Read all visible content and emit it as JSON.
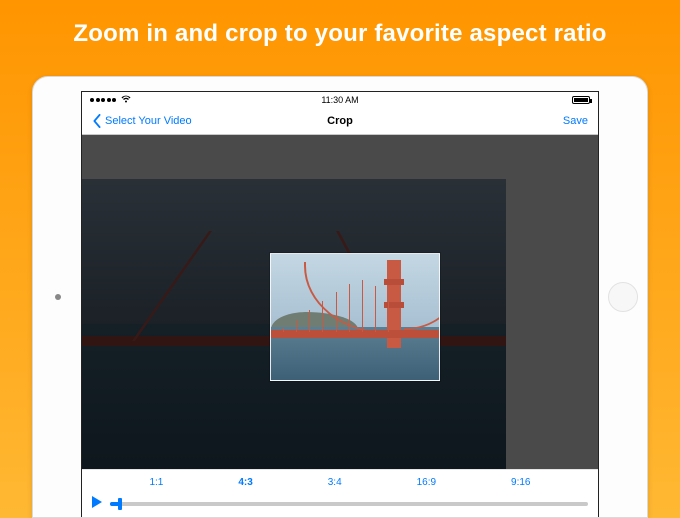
{
  "marketing": {
    "headline": "Zoom in and crop to your favorite aspect ratio"
  },
  "status": {
    "time": "11:30 AM"
  },
  "nav": {
    "back_label": "Select Your Video",
    "title": "Crop",
    "save_label": "Save"
  },
  "ratios": {
    "r1": "1:1",
    "r2": "4:3",
    "r3": "3:4",
    "r4": "16:9",
    "r5": "9:16",
    "selected": "4:3"
  }
}
